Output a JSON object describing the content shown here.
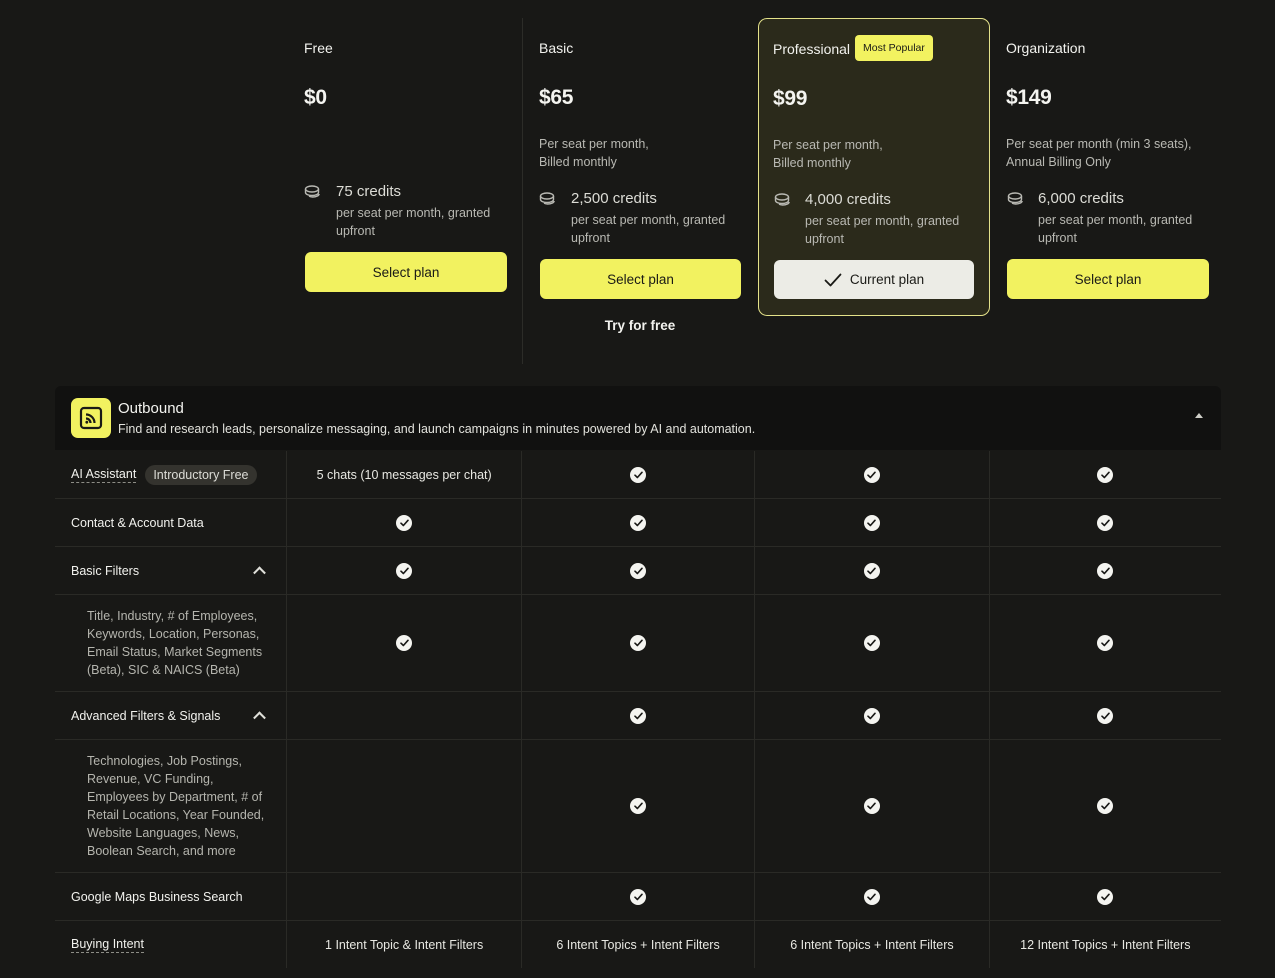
{
  "plans": [
    {
      "name": "Free",
      "price": "$0",
      "billing": "",
      "credits": "75 credits",
      "credits_note": "per seat per month, granted upfront",
      "button": "Select plan"
    },
    {
      "name": "Basic",
      "price": "$65",
      "billing": "Per seat per month, Billed monthly",
      "credits": "2,500 credits",
      "credits_note": "per seat per month, granted upfront",
      "button": "Select plan",
      "secondary": "Try for free"
    },
    {
      "name": "Professional",
      "badge": "Most Popular",
      "price": "$99",
      "billing": "Per seat per month, Billed monthly",
      "credits": "4,000 credits",
      "credits_note": "per seat per month, granted upfront",
      "button": "Current plan"
    },
    {
      "name": "Organization",
      "price": "$149",
      "billing": "Per seat per month (min 3 seats), Annual Billing Only",
      "credits": "6,000 credits",
      "credits_note": "per seat per month, granted upfront",
      "button": "Select plan"
    }
  ],
  "section": {
    "title": "Outbound",
    "description": "Find and research leads, personalize messaging, and launch campaigns in minutes powered by AI and automation."
  },
  "features": [
    {
      "label": "AI Assistant",
      "chip": "Introductory Free",
      "values": [
        "5 chats (10 messages per chat)",
        "check",
        "check",
        "check"
      ]
    },
    {
      "label": "Contact & Account Data",
      "values": [
        "check",
        "check",
        "check",
        "check"
      ]
    },
    {
      "label": "Basic Filters",
      "values": [
        "check",
        "check",
        "check",
        "check"
      ]
    },
    {
      "label": "Title, Industry, # of Employees, Keywords, Location, Personas, Email Status, Market Segments (Beta), SIC & NAICS (Beta)",
      "values": [
        "check",
        "check",
        "check",
        "check"
      ]
    },
    {
      "label": "Advanced Filters & Signals",
      "values": [
        "",
        "check",
        "check",
        "check"
      ]
    },
    {
      "label": "Technologies, Job Postings, Revenue, VC Funding, Employees by Department, # of Retail Locations, Year Founded, Website Languages, News, Boolean Search, and more",
      "values": [
        "",
        "check",
        "check",
        "check"
      ]
    },
    {
      "label": "Google Maps Business Search",
      "values": [
        "",
        "check",
        "check",
        "check"
      ]
    },
    {
      "label": "Buying Intent",
      "values": [
        "1 Intent Topic & Intent Filters",
        "6 Intent Topics + Intent Filters",
        "6 Intent Topics + Intent Filters",
        "12 Intent Topics + Intent Filters"
      ]
    }
  ],
  "colors": {
    "accent": "#f2f260",
    "background": "#181816",
    "card_highlight": "#2b2a1b"
  }
}
